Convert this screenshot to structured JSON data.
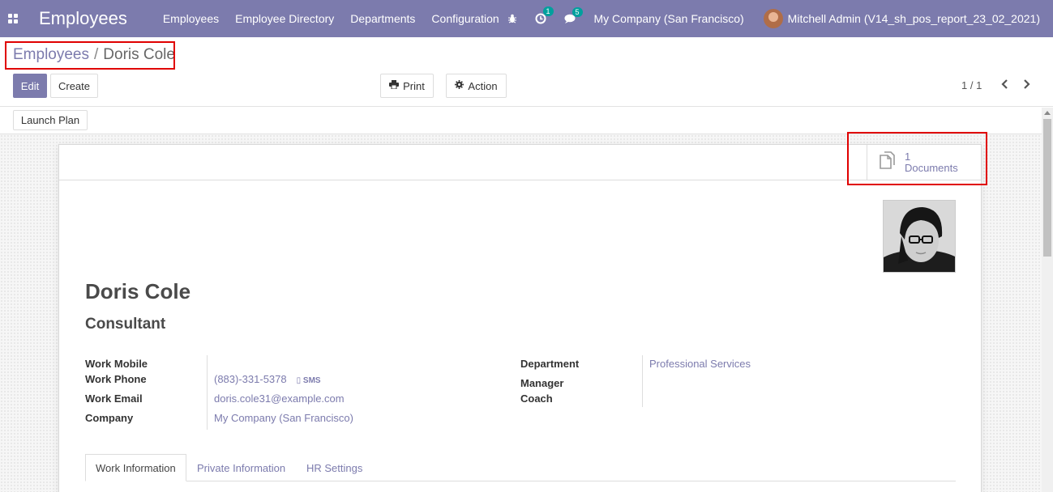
{
  "navbar": {
    "brand": "Employees",
    "menu": [
      "Employees",
      "Employee Directory",
      "Departments",
      "Configuration"
    ],
    "activity_count": "1",
    "messages_count": "5",
    "company": "My Company (San Francisco)",
    "user": "Mitchell Admin (V14_sh_pos_report_23_02_2021)",
    "color": "#7c7bad"
  },
  "breadcrumb": {
    "parent": "Employees",
    "separator": "/",
    "current": "Doris Cole"
  },
  "toolbar": {
    "edit": "Edit",
    "create": "Create",
    "print": "Print",
    "action": "Action",
    "pager": "1 / 1"
  },
  "statusbar": {
    "launch_plan": "Launch Plan"
  },
  "smart_button": {
    "count": "1",
    "label": "Documents"
  },
  "employee": {
    "name": "Doris Cole",
    "job_title": "Consultant"
  },
  "fields_left": {
    "work_mobile_label": "Work Mobile",
    "work_phone_label": "Work Phone",
    "work_phone_value": "(883)-331-5378",
    "sms_label": "SMS",
    "work_email_label": "Work Email",
    "work_email_value": "doris.cole31@example.com",
    "company_label": "Company",
    "company_value": "My Company (San Francisco)"
  },
  "fields_right": {
    "department_label": "Department",
    "department_value": "Professional Services",
    "manager_label": "Manager",
    "coach_label": "Coach"
  },
  "tabs": [
    "Work Information",
    "Private Information",
    "HR Settings"
  ]
}
